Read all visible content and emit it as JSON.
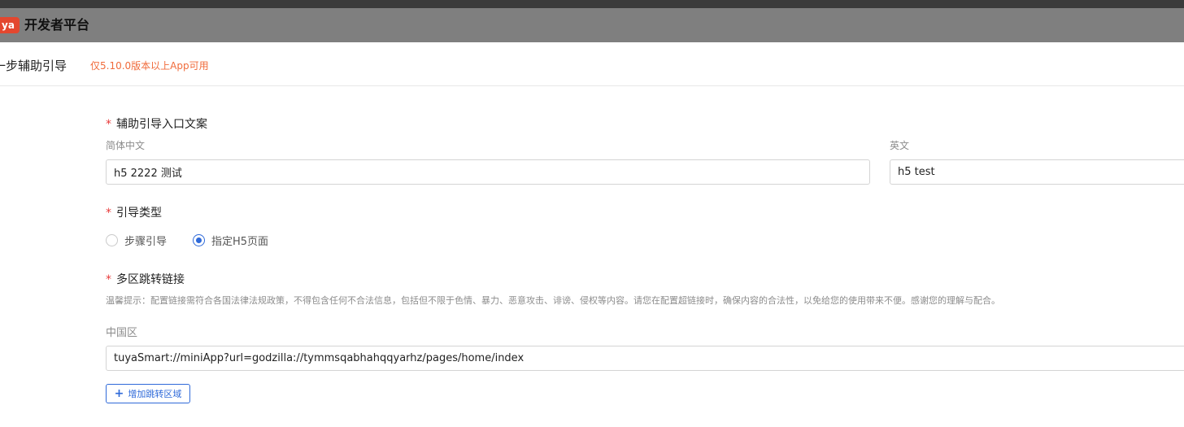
{
  "header": {
    "logo_text": "ya",
    "brand": "开发者平台"
  },
  "page": {
    "title": "一步辅助引导",
    "note": "仅5.10.0版本以上App可用"
  },
  "section_entry": {
    "required_mark": "*",
    "label": "辅助引导入口文案",
    "zh_label": "简体中文",
    "zh_value": "h5 2222 测试",
    "en_label": "英文",
    "en_value": "h5 test"
  },
  "section_type": {
    "required_mark": "*",
    "label": "引导类型",
    "options": [
      {
        "label": "步骤引导",
        "checked": false
      },
      {
        "label": "指定H5页面",
        "checked": true
      }
    ]
  },
  "section_links": {
    "required_mark": "*",
    "label": "多区跳转链接",
    "hint": "温馨提示：配置链接需符合各国法律法规政策，不得包含任何不合法信息，包括但不限于色情、暴力、恶意攻击、诽谤、侵权等内容。请您在配置超链接时，确保内容的合法性，以免给您的使用带来不便。感谢您的理解与配合。",
    "region_label": "中国区",
    "region_value": "tuyaSmart://miniApp?url=godzilla://tymmsqabhahqqyarhz/pages/home/index",
    "add_button": "增加跳转区域"
  },
  "colors": {
    "accent": "#2f6ad9",
    "required": "#e83b3b",
    "note": "#f06b3b",
    "header_bg": "#7f7f7f"
  }
}
